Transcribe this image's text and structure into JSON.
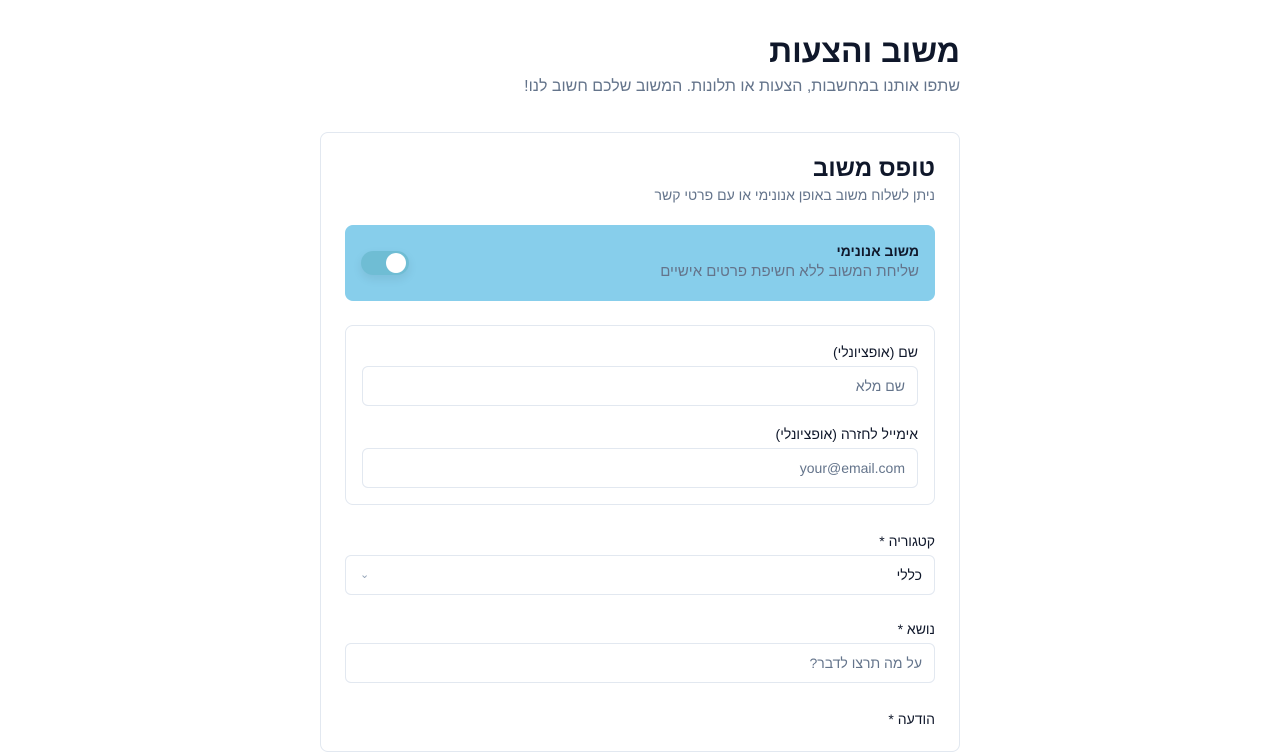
{
  "header": {
    "title": "משוב והצעות",
    "subtitle": "שתפו אותנו במחשבות, הצעות או תלונות. המשוב שלכם חשוב לנו!"
  },
  "form": {
    "title": "טופס משוב",
    "description": "ניתן לשלוח משוב באופן אנונימי או עם פרטי קשר",
    "anonymous": {
      "label": "משוב אנונימי",
      "description": "שליחת המשוב ללא חשיפת פרטים אישיים",
      "enabled": true
    },
    "name": {
      "label": "שם (אופציונלי)",
      "placeholder": "שם מלא"
    },
    "email": {
      "label": "אימייל לחזרה (אופציונלי)",
      "placeholder": "your@email.com"
    },
    "category": {
      "label": "קטגוריה *",
      "value": "כללי"
    },
    "subject": {
      "label": "נושא *",
      "placeholder": "על מה תרצו לדבר?"
    },
    "message": {
      "label": "הודעה *"
    }
  }
}
